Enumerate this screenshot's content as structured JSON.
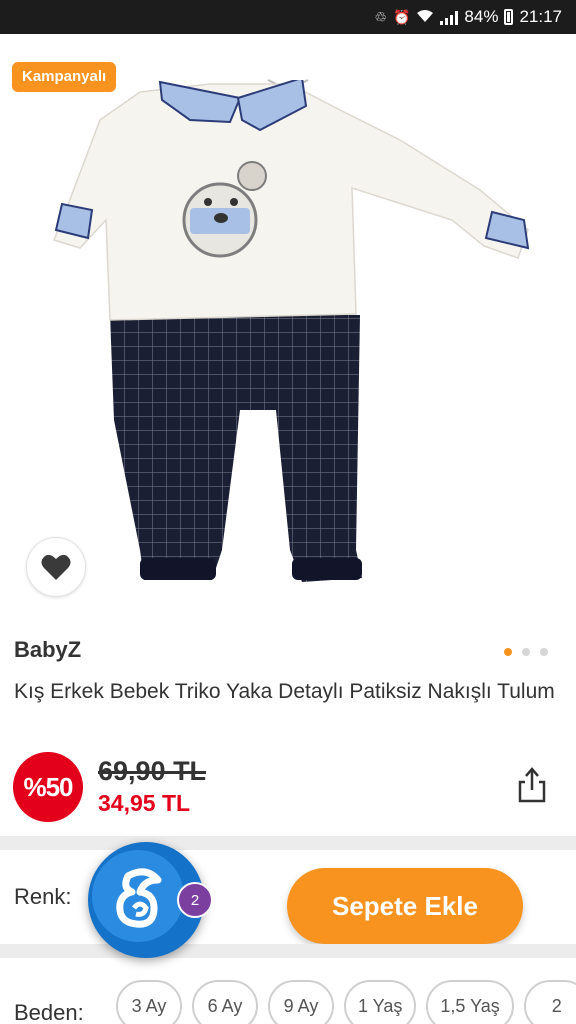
{
  "status_bar": {
    "battery": "84%",
    "time": "21:17"
  },
  "product": {
    "badge": "Kampanyalı",
    "brand": "BabyZ",
    "title": "Kış Erkek Bebek Triko Yaka Detaylı Patiksiz Nakışlı Tulum",
    "discount": "%50",
    "old_price": "69,90 TL",
    "new_price": "34,95 TL",
    "image_count": 3,
    "active_image_index": 0
  },
  "options": {
    "color_label": "Renk:",
    "size_label": "Beden:",
    "sizes": [
      "3 Ay",
      "6 Ay",
      "9 Ay",
      "1 Yaş",
      "1,5 Yaş",
      "2"
    ]
  },
  "actions": {
    "add_to_cart": "Sepete Ekle",
    "chat_count": "2"
  },
  "colors": {
    "accent": "#f7931e",
    "discount_red": "#e3001b",
    "chat_blue": "#1572c9",
    "chat_badge": "#7b3fa0"
  },
  "icons": {
    "favorite": "heart-icon",
    "share": "share-icon",
    "collapse": "chevron-down-icon",
    "chat": "assistant-chat-icon"
  }
}
